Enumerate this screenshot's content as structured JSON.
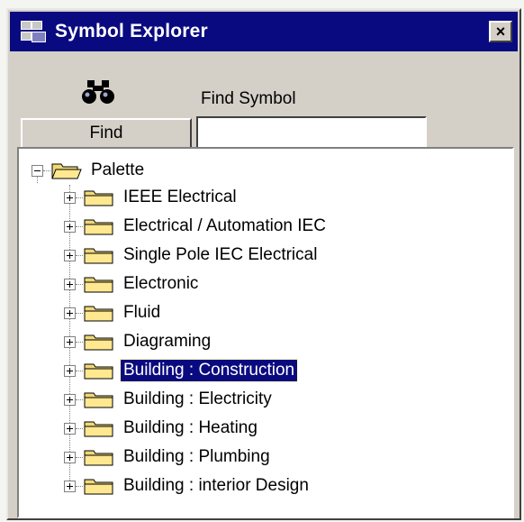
{
  "window": {
    "title": "Symbol Explorer",
    "close_label": "×"
  },
  "toolbar": {
    "find_symbol_label": "Find Symbol",
    "find_button_label": "Find",
    "search_value": ""
  },
  "tree": {
    "root_label": "Palette",
    "items": [
      {
        "label": "IEEE Electrical"
      },
      {
        "label": "Electrical / Automation IEC"
      },
      {
        "label": "Single Pole IEC Electrical"
      },
      {
        "label": "Electronic"
      },
      {
        "label": "Fluid"
      },
      {
        "label": "Diagraming"
      },
      {
        "label": "Building : Construction",
        "selected": true
      },
      {
        "label": "Building : Electricity"
      },
      {
        "label": "Building : Heating"
      },
      {
        "label": "Building : Plumbing"
      },
      {
        "label": "Building : interior Design"
      }
    ]
  },
  "colors": {
    "titlebar": "#0a0a80",
    "window_face": "#d4d0c8",
    "selection": "#0a0a80",
    "folder_fill": "#f0d878"
  }
}
